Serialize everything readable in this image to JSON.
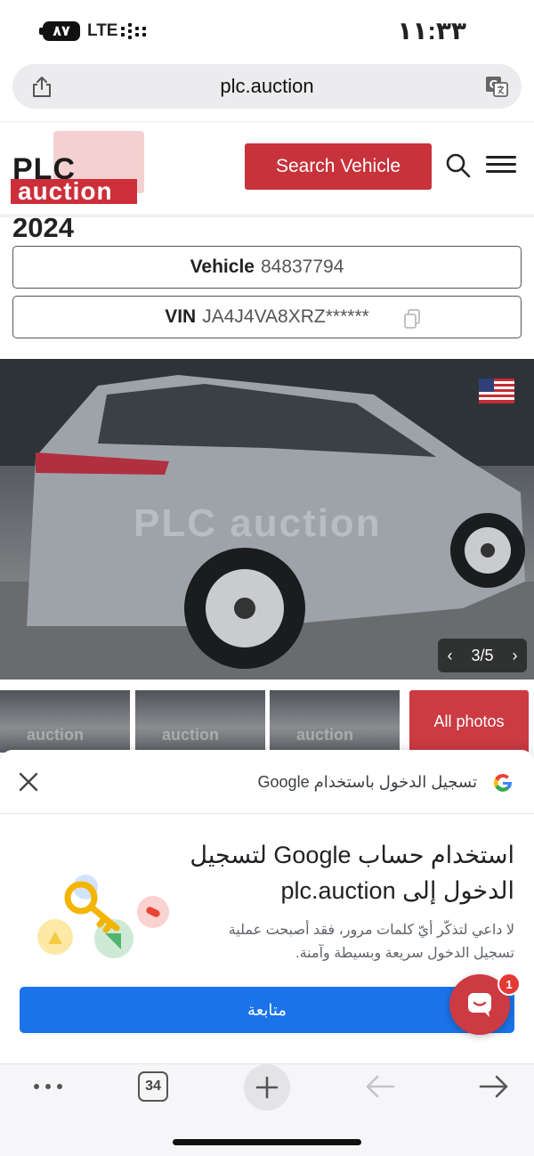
{
  "status_bar": {
    "battery": "٨٧",
    "network": "LTE",
    "time": "١١:٣٣"
  },
  "browser": {
    "url": "plc.auction",
    "share_icon": "share-icon",
    "translate_icon": "translate-icon"
  },
  "header": {
    "logo_top": "PLC",
    "logo_bottom": "auction",
    "search_button": "Search Vehicle",
    "search_icon": "search-icon",
    "menu_icon": "menu-icon"
  },
  "vehicle": {
    "year": "2024",
    "vehicle_label": "Vehicle",
    "vehicle_id": "84837794",
    "vin_label": "VIN",
    "vin_value": "JA4J4VA8XRZ******"
  },
  "gallery": {
    "watermark": "PLC auction",
    "counter": "3/5",
    "all_photos": "All photos",
    "thumb_watermark": "auction"
  },
  "google_signin": {
    "header_title": "تسجيل الدخول باستخدام Google",
    "title": "استخدام حساب Google لتسجيل الدخول إلى plc.auction",
    "description": "لا داعي لتذكّر أيّ كلمات مرور، فقد أصبحت عملية تسجيل الدخول سريعة وبسيطة وآمنة.",
    "continue_button": "متابعة",
    "colors": {
      "button": "#1a73e8"
    }
  },
  "chat": {
    "badge": "1",
    "accent": "#cc3a42"
  },
  "toolbar": {
    "tab_count": "34"
  },
  "colors": {
    "brand_red": "#c8323b",
    "logo_dark": "#1c1c1c"
  }
}
